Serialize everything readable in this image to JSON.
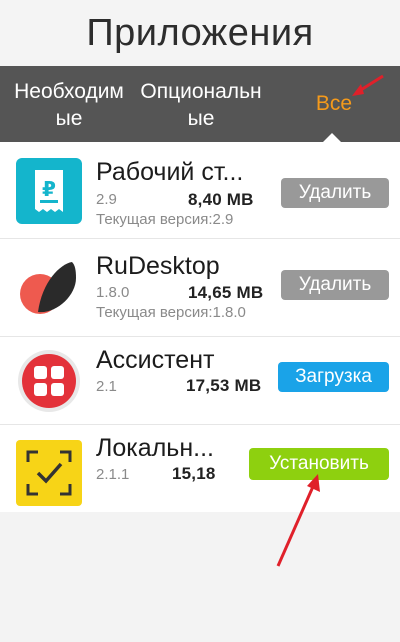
{
  "header": {
    "title": "Приложения"
  },
  "tabs": [
    {
      "line1": "Необходим",
      "line2": "ые"
    },
    {
      "line1": "Опциональн",
      "line2": "ые"
    },
    {
      "label": "Все",
      "active": true
    }
  ],
  "colors": {
    "active_tab": "#f59a1b",
    "tab_bar": "#555555",
    "btn_delete": "#999999",
    "btn_load": "#1aa3e8",
    "btn_install": "#8ed00f",
    "annotation": "#e0202a"
  },
  "apps": [
    {
      "name": "Рабочий ст...",
      "version": "2.9",
      "size": "8,40 MB",
      "current": "Текущая версия:2.9",
      "button": "Удалить",
      "icon": "receipt-icon"
    },
    {
      "name": "RuDesktop",
      "version": "1.8.0",
      "size": "14,65 MB",
      "current": "Текущая версия:1.8.0",
      "button": "Удалить",
      "icon": "rudesktop-logo-icon"
    },
    {
      "name": "Ассистент",
      "version": "2.1",
      "size": "17,53 MB",
      "button": "Загрузка",
      "icon": "assistant-grid-icon"
    },
    {
      "name": "Локальн...",
      "version": "2.1.1",
      "size": "15,18",
      "button": "Установить",
      "icon": "face-scan-icon"
    }
  ]
}
